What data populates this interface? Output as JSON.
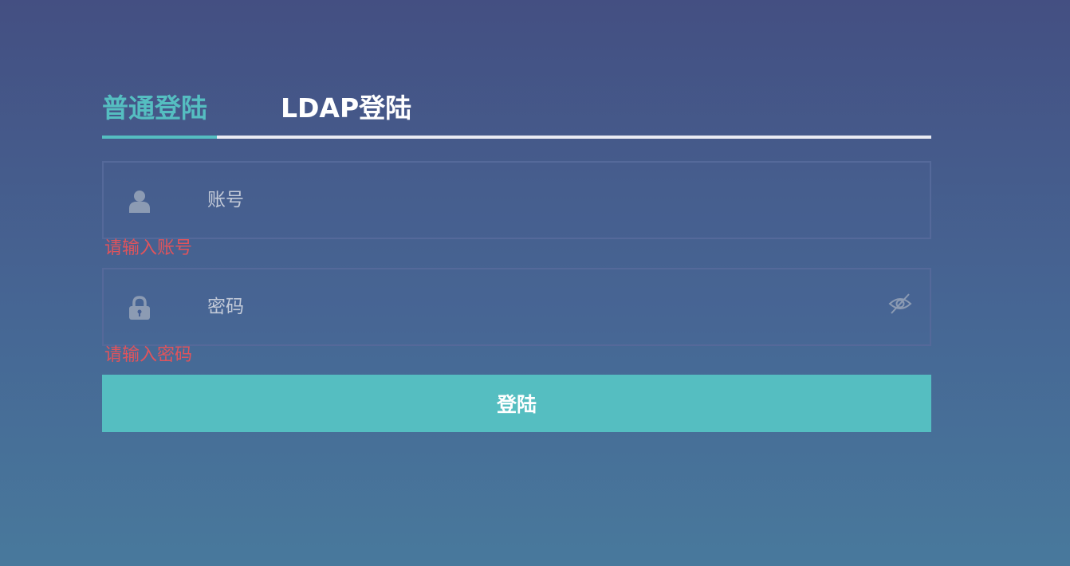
{
  "tabs": {
    "normal": "普通登陆",
    "ldap": "LDAP登陆",
    "active": "normal",
    "accent_color": "#55bec1"
  },
  "username": {
    "icon": "user-icon",
    "value": "",
    "placeholder": "账号",
    "error": "请输入账号"
  },
  "password": {
    "icon": "lock-icon",
    "toggle_icon": "eye-slash-icon",
    "value": "",
    "placeholder": "密码",
    "error": "请输入密码"
  },
  "submit": {
    "label": "登陆"
  },
  "colors": {
    "error": "#e0545c",
    "background_top": "#444f82",
    "background_bottom": "#48799c"
  }
}
